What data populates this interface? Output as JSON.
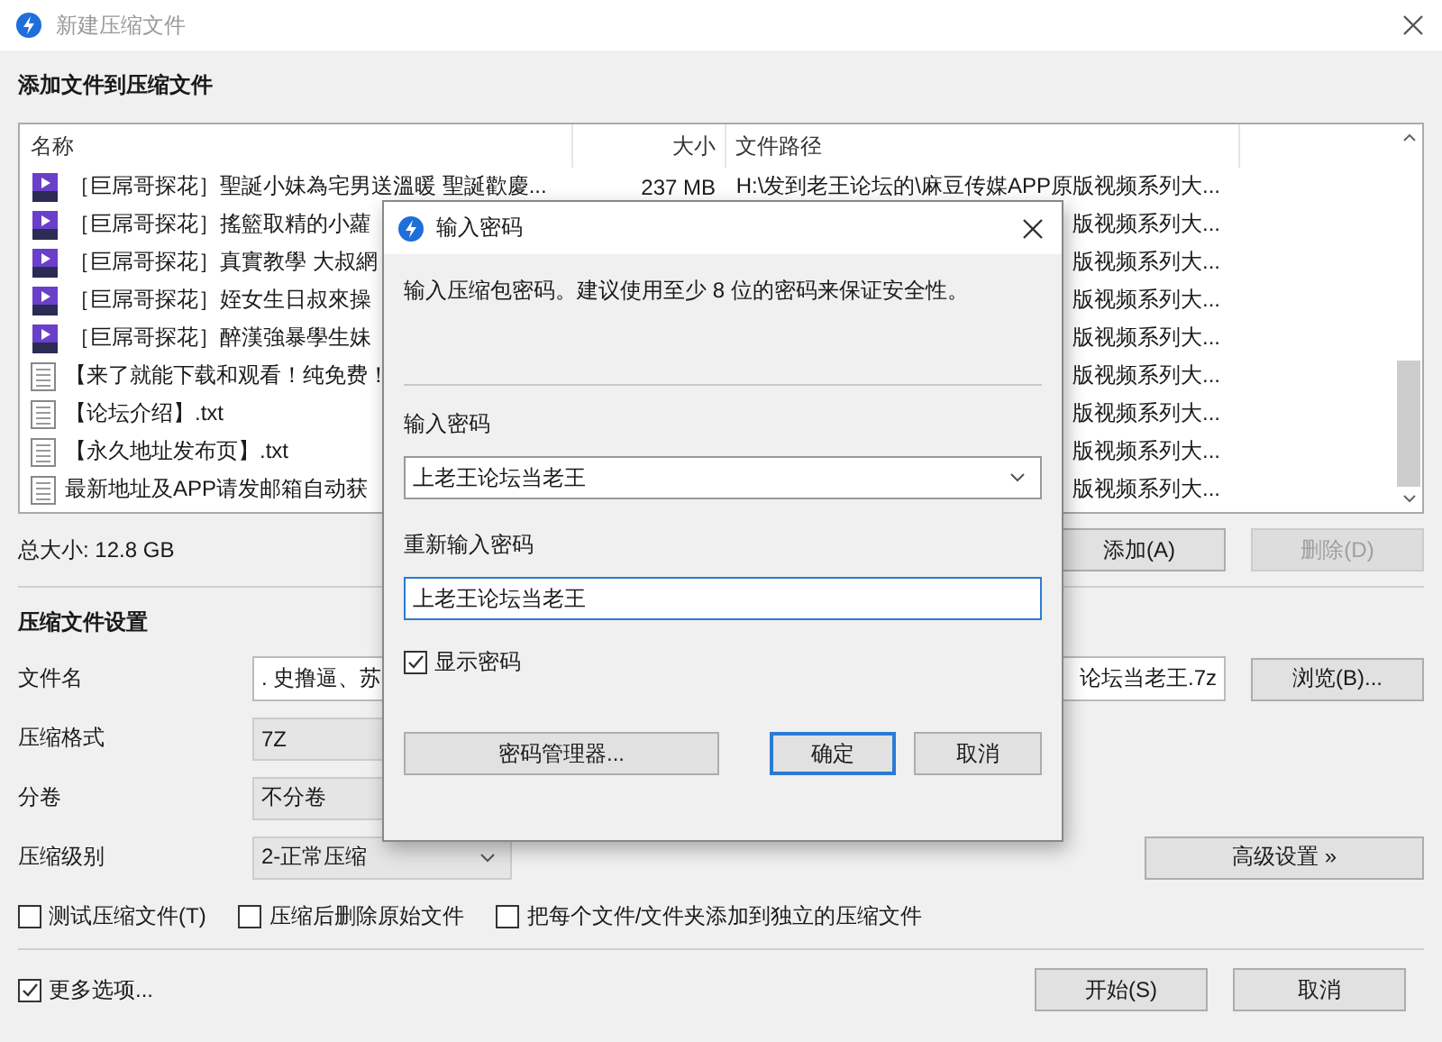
{
  "window": {
    "title": "新建压缩文件"
  },
  "add_section": {
    "heading": "添加文件到压缩文件"
  },
  "file_list": {
    "columns": [
      "名称",
      "大小",
      "文件路径"
    ],
    "rows": [
      {
        "kind": "video",
        "name": "［巨屌哥探花］聖誕小妹為宅男送溫暖 聖誕歡慶...",
        "size": "237 MB",
        "path": "H:\\发到老王论坛的\\麻豆传媒APP原版视频系列大..."
      },
      {
        "kind": "video",
        "name": "［巨屌哥探花］搖籃取精的小蘿",
        "path": "版视频系列大..."
      },
      {
        "kind": "video",
        "name": "［巨屌哥探花］真實教學 大叔網",
        "path": "版视频系列大..."
      },
      {
        "kind": "video",
        "name": "［巨屌哥探花］姪女生日叔來操",
        "path": "版视频系列大..."
      },
      {
        "kind": "video",
        "name": "［巨屌哥探花］醉漢強暴學生妹",
        "path": "版视频系列大..."
      },
      {
        "kind": "text",
        "name": "【来了就能下载和观看！纯免费！",
        "path": "版视频系列大..."
      },
      {
        "kind": "text",
        "name": "【论坛介绍】.txt",
        "path": "版视频系列大..."
      },
      {
        "kind": "text",
        "name": "【永久地址发布页】.txt",
        "path": "版视频系列大..."
      },
      {
        "kind": "text",
        "name": "最新地址及APP请发邮箱自动获",
        "path": "版视频系列大..."
      }
    ]
  },
  "total_size": "总大小: 12.8 GB",
  "list_buttons": [
    {
      "label": "添加(A)",
      "disabled": false
    },
    {
      "label": "删除(D)",
      "disabled": true
    }
  ],
  "settings": {
    "heading": "压缩文件设置",
    "filename": {
      "label": "文件名",
      "value_start": ". 史撸逼、苏",
      "value_end": "论坛当老王.7z",
      "button": "浏览(B)..."
    },
    "format": {
      "label": "压缩格式",
      "value": "7Z"
    },
    "split": {
      "label": "分卷",
      "value": "不分卷"
    },
    "level": {
      "label": "压缩级别",
      "value": "2-正常压缩"
    },
    "advanced_button": "高级设置 »",
    "options": [
      {
        "label": "测试压缩文件(T)",
        "checked": false
      },
      {
        "label": "压缩后删除原始文件",
        "checked": false
      },
      {
        "label": "把每个文件/文件夹添加到独立的压缩文件",
        "checked": false
      }
    ]
  },
  "more_options": {
    "label": "更多选项...",
    "checked": true
  },
  "footer_buttons": [
    "开始(S)",
    "取消"
  ],
  "password_dialog": {
    "title": "输入密码",
    "description": "输入压缩包密码。建议使用至少 8 位的密码来保证安全性。",
    "password": {
      "label": "输入密码",
      "value": "上老王论坛当老王"
    },
    "confirm": {
      "label": "重新输入密码",
      "value": "上老王论坛当老王"
    },
    "show_password": {
      "label": "显示密码",
      "checked": true
    },
    "buttons": [
      {
        "label": "密码管理器...",
        "default": false
      },
      {
        "label": "确定",
        "default": true
      },
      {
        "label": "取消",
        "default": false
      }
    ]
  }
}
